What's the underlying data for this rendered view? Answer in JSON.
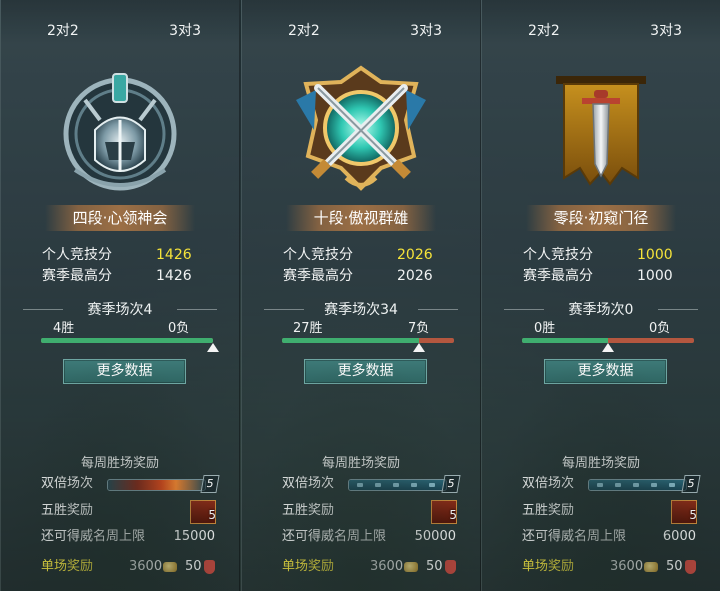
{
  "panels": [
    {
      "tabs": [
        "2对2",
        "3对3"
      ],
      "emblem": "silver-helmet-emblem",
      "rank_title": "四段·心领神会",
      "personal_score_label": "个人竞技分",
      "personal_score": "1426",
      "season_high_label": "赛季最高分",
      "season_high": "1426",
      "season_games": "赛季场次4",
      "wins": "4胜",
      "losses": "0负",
      "win_ratio": 1.0,
      "more_data": "更多数据",
      "weekly_title": "每周胜场奖励",
      "double_label": "双倍场次",
      "double_value": "5",
      "double_state": "active",
      "five_win_label": "五胜奖励",
      "five_win_count": "5",
      "prestige_label": "还可得威名周上限",
      "prestige_value": "15000",
      "single_label": "单场奖励",
      "single_coins": "3600",
      "single_honor": "50"
    },
    {
      "tabs": [
        "2对2",
        "3对3"
      ],
      "emblem": "crossed-swords-shield-emblem",
      "rank_title": "十段·傲视群雄",
      "personal_score_label": "个人竞技分",
      "personal_score": "2026",
      "season_high_label": "赛季最高分",
      "season_high": "2026",
      "season_games": "赛季场次34",
      "wins": "27胜",
      "losses": "7负",
      "win_ratio": 0.794,
      "more_data": "更多数据",
      "weekly_title": "每周胜场奖励",
      "double_label": "双倍场次",
      "double_value": "5",
      "double_state": "full",
      "five_win_label": "五胜奖励",
      "five_win_count": "5",
      "prestige_label": "还可得威名周上限",
      "prestige_value": "50000",
      "single_label": "单场奖励",
      "single_coins": "3600",
      "single_honor": "50"
    },
    {
      "tabs": [
        "2对2",
        "3对3"
      ],
      "emblem": "banner-sword-emblem",
      "rank_title": "零段·初窥门径",
      "personal_score_label": "个人竞技分",
      "personal_score": "1000",
      "season_high_label": "赛季最高分",
      "season_high": "1000",
      "season_games": "赛季场次0",
      "wins": "0胜",
      "losses": "0负",
      "win_ratio": 0.5,
      "more_data": "更多数据",
      "weekly_title": "每周胜场奖励",
      "double_label": "双倍场次",
      "double_value": "5",
      "double_state": "full",
      "five_win_label": "五胜奖励",
      "five_win_count": "5",
      "prestige_label": "还可得威名周上限",
      "prestige_value": "6000",
      "single_label": "单场奖励",
      "single_coins": "3600",
      "single_honor": "50"
    }
  ],
  "colors": {
    "gold_score": "#f5e33a",
    "win_bar": "#3fae6f",
    "loss_bar": "#b4573f",
    "button": "#3e7a78",
    "single_reward_label": "#f3e441"
  }
}
